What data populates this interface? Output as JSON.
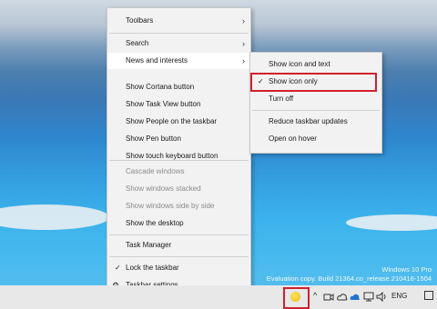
{
  "desktop": {
    "watermark_line1": "Windows 10 Pro",
    "watermark_line2": "Evaluation copy. Build 21364.co_release.210416-1504"
  },
  "context_menu": {
    "toolbars": "Toolbars",
    "search": "Search",
    "news": "News and interests",
    "show_cortana": "Show Cortana button",
    "show_task_view": "Show Task View button",
    "show_people": "Show People on the taskbar",
    "show_pen": "Show Pen button",
    "show_touch_keyboard": "Show touch keyboard button",
    "cascade": "Cascade windows",
    "stacked": "Show windows stacked",
    "side_by_side": "Show windows side by side",
    "show_desktop": "Show the desktop",
    "task_manager": "Task Manager",
    "lock_taskbar": "Lock the taskbar",
    "taskbar_settings": "Taskbar settings"
  },
  "submenu": {
    "show_icon_text": "Show icon and text",
    "show_icon_only": "Show icon only",
    "turn_off": "Turn off",
    "reduce_updates": "Reduce taskbar updates",
    "open_hover": "Open on hover"
  },
  "icons": {
    "arrow": "›",
    "check": "✓",
    "gear": "⚙",
    "chevron_up": "^",
    "keyboard_lang": "ENG"
  },
  "colors": {
    "highlight_box": "#d0202e",
    "menu_bg": "#f2f2f2",
    "taskbar_bg": "#e8e8e8"
  }
}
